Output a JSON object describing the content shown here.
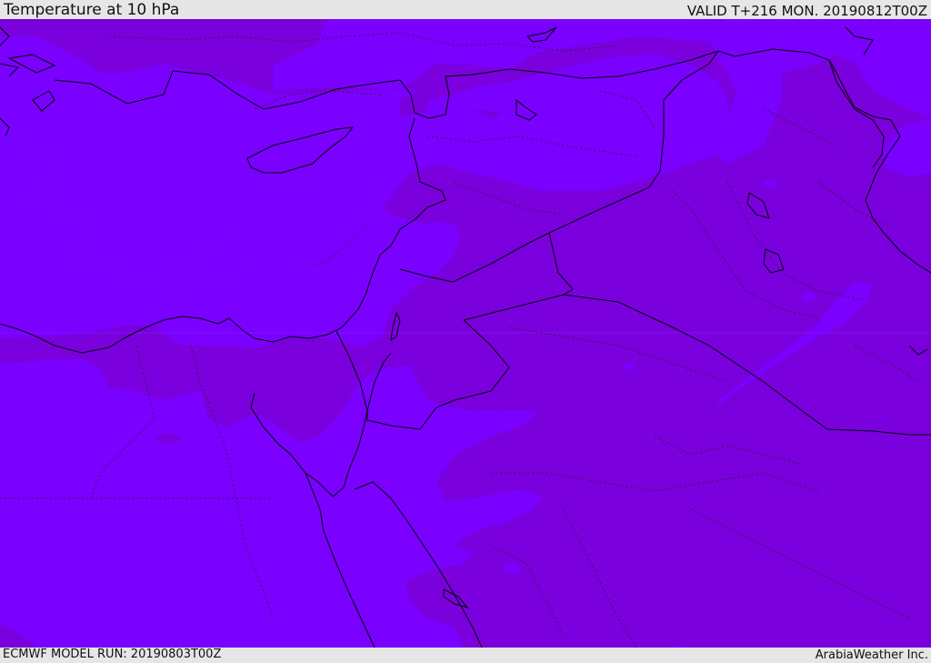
{
  "header": {
    "title": "Temperature at 10 hPa",
    "valid": "VALID T+216 MON. 20190812T00Z"
  },
  "footer": {
    "model_run": "ECMWF MODEL RUN: 20190803T00Z",
    "credit": "ArabiaWeather Inc."
  },
  "colors": {
    "field_light": "#7a00ff",
    "field_dark": "#7a00dd",
    "border": "#000000",
    "frame": "#e6e6e6"
  }
}
